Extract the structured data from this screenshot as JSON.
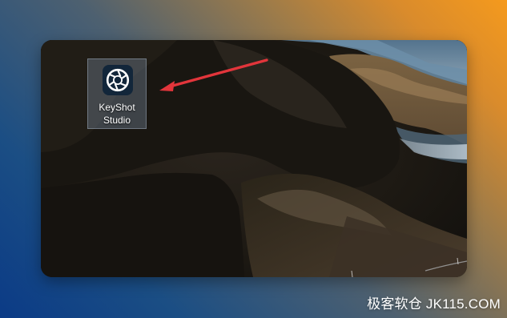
{
  "desktop": {
    "icon": {
      "name": "KeyShot Studio",
      "label_lines": [
        "KeyShot",
        "Studio"
      ]
    }
  },
  "watermark": {
    "text": "极客软仓 JK115.COM"
  },
  "colors": {
    "background_gradient": [
      "#0b3b86",
      "#f59a1d"
    ],
    "arrow": "#e2353b",
    "icon_bg": "#12263a",
    "icon_accent": "#ffffff",
    "icon_selection": "#73849a"
  },
  "icons": {
    "app_icon": "keyshot-aperture-icon",
    "pointer": "red-arrow-icon"
  }
}
